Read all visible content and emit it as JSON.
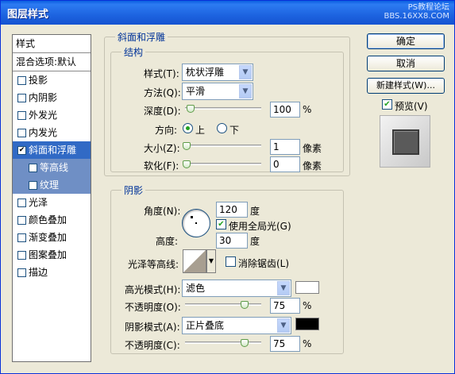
{
  "window": {
    "title": "图层样式",
    "watermark_line1": "PS教程论坛",
    "watermark_line2": "BBS.16XX8.COM"
  },
  "sidebar": {
    "header": "样式",
    "blend_options": "混合选项:默认",
    "items": [
      {
        "label": "投影",
        "checked": false
      },
      {
        "label": "内阴影",
        "checked": false
      },
      {
        "label": "外发光",
        "checked": false
      },
      {
        "label": "内发光",
        "checked": false
      },
      {
        "label": "斜面和浮雕",
        "checked": true,
        "selected": true
      },
      {
        "label": "等高线",
        "checked": false,
        "sub": true
      },
      {
        "label": "纹理",
        "checked": false,
        "sub": true
      },
      {
        "label": "光泽",
        "checked": false
      },
      {
        "label": "颜色叠加",
        "checked": false
      },
      {
        "label": "渐变叠加",
        "checked": false
      },
      {
        "label": "图案叠加",
        "checked": false
      },
      {
        "label": "描边",
        "checked": false
      }
    ]
  },
  "bevel": {
    "section_title": "斜面和浮雕",
    "structure_title": "结构",
    "style_label": "样式(T):",
    "style_value": "枕状浮雕",
    "technique_label": "方法(Q):",
    "technique_value": "平滑",
    "depth_label": "深度(D):",
    "depth_value": "100",
    "depth_unit": "%",
    "depth_level": 0.05,
    "direction_label": "方向:",
    "direction_up": "上",
    "direction_down": "下",
    "size_label": "大小(Z):",
    "size_value": "1",
    "size_unit": "像素",
    "size_level": 0.0,
    "soften_label": "软化(F):",
    "soften_value": "0",
    "soften_unit": "像素",
    "soften_level": 0.0
  },
  "shading": {
    "title": "阴影",
    "angle_label": "角度(N):",
    "angle_value": "120",
    "angle_unit": "度",
    "global_light_label": "使用全局光(G)",
    "altitude_label": "高度:",
    "altitude_value": "30",
    "altitude_unit": "度",
    "gloss_contour_label": "光泽等高线:",
    "anti_aliased_label": "消除锯齿(L)",
    "highlight_mode_label": "高光模式(H):",
    "highlight_mode_value": "滤色",
    "highlight_color": "#ffffff",
    "highlight_opacity_label": "不透明度(O):",
    "highlight_opacity_value": "75",
    "highlight_opacity_unit": "%",
    "highlight_opacity_level": 0.75,
    "shadow_mode_label": "阴影模式(A):",
    "shadow_mode_value": "正片叠底",
    "shadow_color": "#000000",
    "shadow_opacity_label": "不透明度(C):",
    "shadow_opacity_value": "75",
    "shadow_opacity_unit": "%",
    "shadow_opacity_level": 0.75
  },
  "buttons": {
    "ok": "确定",
    "cancel": "取消",
    "new_style": "新建样式(W)...",
    "preview_label": "预览(V)"
  },
  "colors": {
    "selection": "#316ac5",
    "sub_selection": "#6f8fc5",
    "section_title": "#003399"
  }
}
